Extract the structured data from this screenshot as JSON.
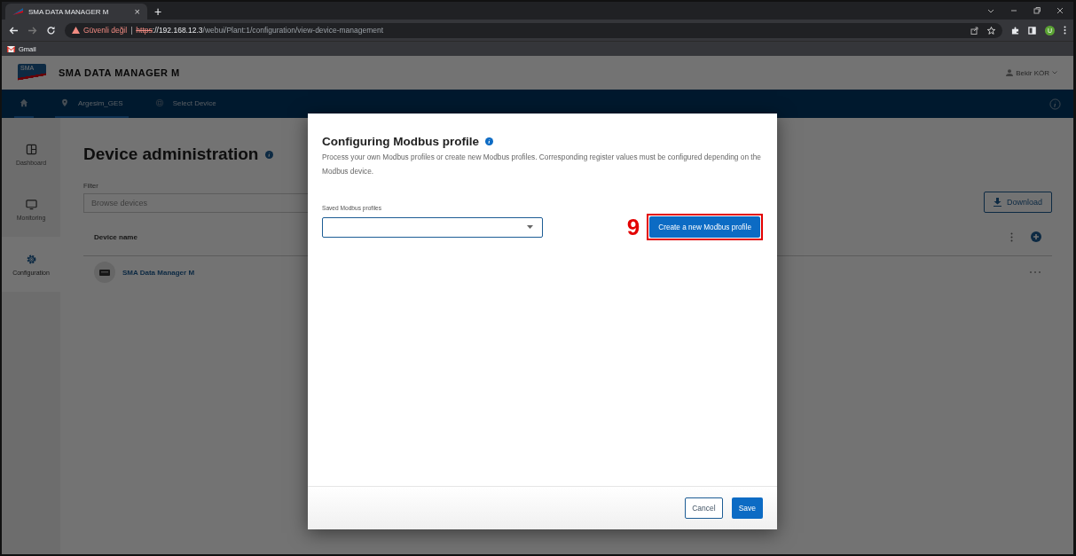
{
  "browser": {
    "tab_title": "SMA DATA MANAGER M",
    "tab_close": "×",
    "new_tab": "+",
    "security_warning": "Güvenli değil",
    "separator": "|",
    "url": {
      "scheme": "https",
      "host": "://192.168.12.3",
      "path": "/webui/Plant:1/configuration/view-device-management"
    },
    "bookmarks": [
      "Gmail"
    ],
    "profile_initial": "U"
  },
  "app_header": {
    "logo": "SMA",
    "title": "SMA DATA MANAGER M",
    "user": "Bekir KÖR"
  },
  "nav": {
    "items": [
      {
        "kind": "home"
      },
      {
        "kind": "plant",
        "label": "Argesim_GES"
      },
      {
        "kind": "device",
        "label": "Select Device"
      }
    ]
  },
  "sidebar": {
    "items": [
      {
        "kind": "dashboard",
        "label": "Dashboard",
        "selected": false
      },
      {
        "kind": "monitoring",
        "label": "Monitoring",
        "selected": false
      },
      {
        "kind": "configuration",
        "label": "Configuration",
        "selected": true
      }
    ]
  },
  "page": {
    "title": "Device administration",
    "filter_label": "Filter",
    "filter_placeholder": "Browse devices",
    "download": "Download",
    "table": {
      "columns": [
        "Device name"
      ],
      "rows": [
        {
          "name": "SMA Data Manager M"
        }
      ]
    }
  },
  "modal": {
    "title": "Configuring Modbus profile",
    "description": "Process your own Modbus profiles or create new Modbus profiles. Corresponding register values must be configured depending on the Modbus device.",
    "field_label": "Saved Modbus profiles",
    "create_button": "Create a new Modbus profile",
    "step_marker": "9",
    "cancel": "Cancel",
    "save": "Save"
  }
}
